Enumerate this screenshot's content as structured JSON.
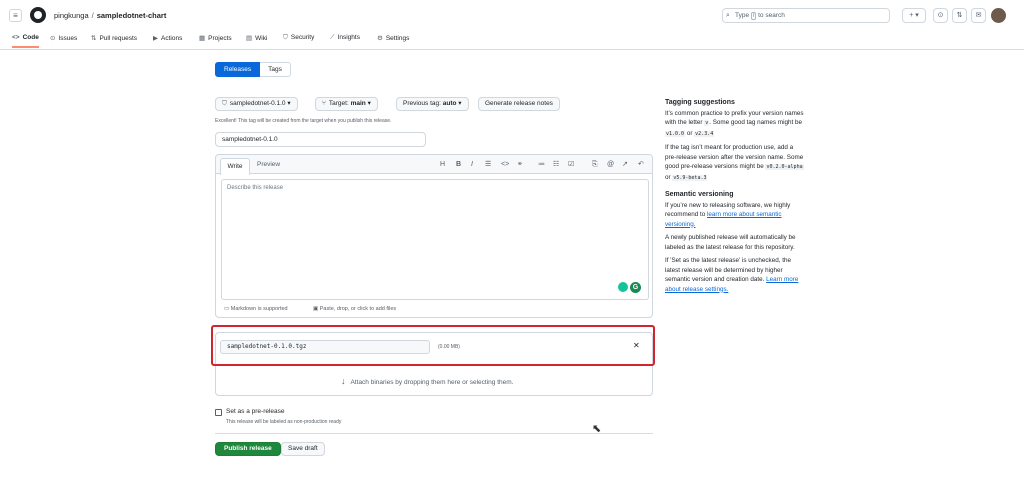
{
  "header": {
    "owner": "pingkunga",
    "separator": "/",
    "repo": "sampledotnet-chart",
    "search_prefix": "Type",
    "search_key": "/",
    "search_suffix": "to search",
    "icons": {
      "menu": "hamburger-icon",
      "logo": "github-logo",
      "add": "plus-icon",
      "issues": "circle-dot-icon",
      "pulls": "git-pull-request-icon",
      "inbox": "inbox-icon"
    }
  },
  "nav": {
    "items": [
      {
        "label": "Code",
        "icon": "<>"
      },
      {
        "label": "Issues",
        "icon": "⊙"
      },
      {
        "label": "Pull requests",
        "icon": "⇅"
      },
      {
        "label": "Actions",
        "icon": "▶"
      },
      {
        "label": "Projects",
        "icon": "▦"
      },
      {
        "label": "Wiki",
        "icon": "▤"
      },
      {
        "label": "Security",
        "icon": "⛉"
      },
      {
        "label": "Insights",
        "icon": "⟋"
      },
      {
        "label": "Settings",
        "icon": "⚙"
      }
    ]
  },
  "release": {
    "tab_releases": "Releases",
    "tab_tags": "Tags",
    "tag_button": "sampledotnet-0.1.0",
    "target_label": "Target:",
    "target_value": "main",
    "previous_tag_label": "Previous tag:",
    "previous_tag_value": "auto",
    "generate_notes": "Generate release notes",
    "hint": "Excellent! This tag will be created from the target when you publish this release.",
    "title_value": "sampledotnet-0.1.0",
    "tab_write": "Write",
    "tab_preview": "Preview",
    "body_placeholder": "Describe this release",
    "markdown_note": "Markdown is supported",
    "attach_note": "Paste, drop, or click to add files",
    "asset_filename": "sampledotnet-0.1.0.tgz",
    "asset_size": "(0.00 MB)",
    "dropzone_text": "Attach binaries by dropping them here or selecting them.",
    "prerelease_label": "Set as a pre-release",
    "prerelease_hint": "This release will be labeled as non-production ready",
    "publish_label": "Publish release",
    "save_draft_label": "Save draft"
  },
  "sidebar": {
    "tag_title": "Tagging suggestions",
    "tag_p1_a": "It’s common practice to prefix your version names with the letter",
    "tag_p1_code1": "v",
    "tag_p1_b": ". Some good tag names might be",
    "tag_p1_code2": "v1.0.0",
    "tag_p1_c": "or",
    "tag_p1_code3": "v2.3.4",
    "tag_p2_a": "If the tag isn’t meant for production use, add a pre-release version after the version name. Some good pre-release versions might be",
    "tag_p2_code1": "v0.2.0-alpha",
    "tag_p2_b": "or",
    "tag_p2_code2": "v5.9-beta.3",
    "semver_title": "Semantic versioning",
    "semver_p1_a": "If you’re new to releasing software, we highly recommend to",
    "semver_p1_link": "learn more about semantic versioning.",
    "semver_p2": "A newly published release will automatically be labeled as the latest release for this repository.",
    "semver_p3_a": "If 'Set as the latest release' is unchecked, the latest release will be determined by higher semantic version and creation date.",
    "semver_p3_link": "Learn more about release settings."
  }
}
